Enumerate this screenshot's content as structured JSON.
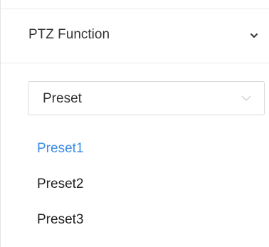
{
  "panel": {
    "title": "PTZ Function",
    "collapse_icon": "chevron-down-icon"
  },
  "mode_select": {
    "value": "Preset",
    "arrow_icon": "chevron-down-icon"
  },
  "presets": [
    {
      "label": "Preset1",
      "active": true
    },
    {
      "label": "Preset2",
      "active": false
    },
    {
      "label": "Preset3",
      "active": false
    }
  ],
  "colors": {
    "active": "#3b8de8",
    "text": "#222222",
    "border": "#d9d9d9"
  }
}
